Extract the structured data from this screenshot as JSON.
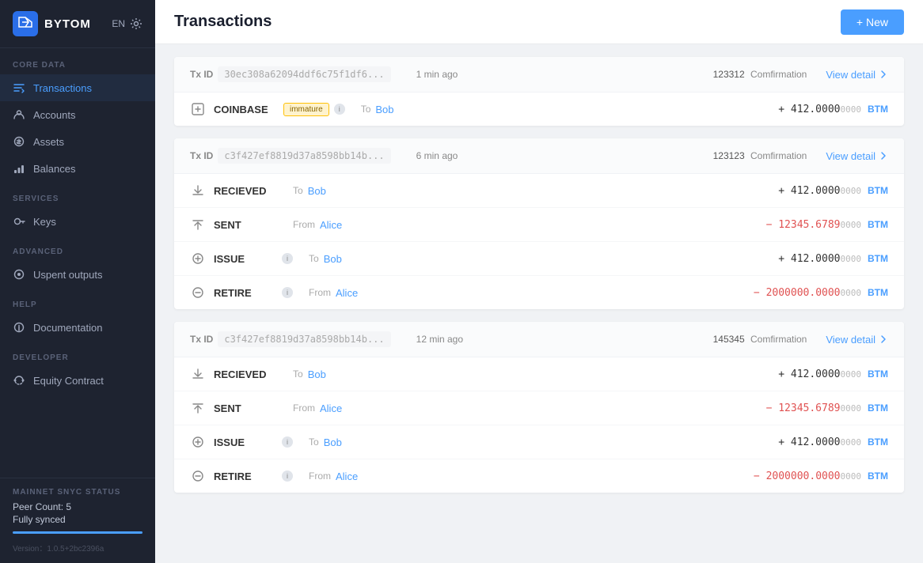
{
  "app": {
    "logo": "BYTOM",
    "lang": "EN",
    "page_title": "Transactions",
    "new_button": "+ New"
  },
  "sidebar": {
    "sections": [
      {
        "label": "CORE DATA",
        "items": [
          {
            "id": "transactions",
            "label": "Transactions",
            "icon": "tx-icon",
            "active": true
          },
          {
            "id": "accounts",
            "label": "Accounts",
            "icon": "accounts-icon",
            "active": false
          },
          {
            "id": "assets",
            "label": "Assets",
            "icon": "assets-icon",
            "active": false
          },
          {
            "id": "balances",
            "label": "Balances",
            "icon": "balances-icon",
            "active": false
          }
        ]
      },
      {
        "label": "SERVICES",
        "items": [
          {
            "id": "keys",
            "label": "Keys",
            "icon": "keys-icon",
            "active": false
          }
        ]
      },
      {
        "label": "ADVANCED",
        "items": [
          {
            "id": "unspent",
            "label": "Uspent outputs",
            "icon": "unspent-icon",
            "active": false
          }
        ]
      },
      {
        "label": "HELP",
        "items": [
          {
            "id": "docs",
            "label": "Documentation",
            "icon": "docs-icon",
            "active": false
          }
        ]
      },
      {
        "label": "DEVELOPER",
        "items": [
          {
            "id": "equity",
            "label": "Equity Contract",
            "icon": "equity-icon",
            "active": false
          }
        ]
      }
    ],
    "sync": {
      "label": "MAINNET SNYC STATUS",
      "peer_count": "Peer Count: 5",
      "status": "Fully synced",
      "bar_width": "100%"
    },
    "version": "Version：1.0.5+2bc2396a"
  },
  "transactions": [
    {
      "tx_id": "30ec308a62094ddf6c75f1df6...",
      "time": "1 min ago",
      "confirmation_num": "123312",
      "confirmation_label": "Comfirmation",
      "view_detail": "View detail",
      "rows": [
        {
          "type": "COINBASE",
          "badge": "immature",
          "badge_class": "immature",
          "direction": "To",
          "name": "Bob",
          "amount_sign": "+",
          "amount_main": "412.0000",
          "amount_small": "0000",
          "currency": "BTM",
          "is_positive": true
        }
      ]
    },
    {
      "tx_id": "c3f427ef8819d37a8598bb14b...",
      "time": "6 min ago",
      "confirmation_num": "123123",
      "confirmation_label": "Comfirmation",
      "view_detail": "View detail",
      "rows": [
        {
          "type": "RECIEVED",
          "badge": null,
          "direction": "To",
          "name": "Bob",
          "amount_sign": "+",
          "amount_main": "412.0000",
          "amount_small": "0000",
          "currency": "BTM",
          "is_positive": true
        },
        {
          "type": "SENT",
          "badge": null,
          "direction": "From",
          "name": "Alice",
          "amount_sign": "−",
          "amount_main": "12345.6789",
          "amount_small": "0000",
          "currency": "BTM",
          "is_positive": false
        },
        {
          "type": "ISSUE",
          "badge": "info",
          "direction": "To",
          "name": "Bob",
          "amount_sign": "+",
          "amount_main": "412.0000",
          "amount_small": "0000",
          "currency": "BTM",
          "is_positive": true
        },
        {
          "type": "RETIRE",
          "badge": "info",
          "direction": "From",
          "name": "Alice",
          "amount_sign": "−",
          "amount_main": "2000000.0000",
          "amount_small": "0000",
          "currency": "BTM",
          "is_positive": false
        }
      ]
    },
    {
      "tx_id": "c3f427ef8819d37a8598bb14b...",
      "time": "12 min ago",
      "confirmation_num": "145345",
      "confirmation_label": "Comfirmation",
      "view_detail": "View detail",
      "rows": [
        {
          "type": "RECIEVED",
          "badge": null,
          "direction": "To",
          "name": "Bob",
          "amount_sign": "+",
          "amount_main": "412.0000",
          "amount_small": "0000",
          "currency": "BTM",
          "is_positive": true
        },
        {
          "type": "SENT",
          "badge": null,
          "direction": "From",
          "name": "Alice",
          "amount_sign": "−",
          "amount_main": "12345.6789",
          "amount_small": "0000",
          "currency": "BTM",
          "is_positive": false
        },
        {
          "type": "ISSUE",
          "badge": "info",
          "direction": "To",
          "name": "Bob",
          "amount_sign": "+",
          "amount_main": "412.0000",
          "amount_small": "0000",
          "currency": "BTM",
          "is_positive": true
        },
        {
          "type": "RETIRE",
          "badge": "info",
          "direction": "From",
          "name": "Alice",
          "amount_sign": "−",
          "amount_main": "2000000.0000",
          "amount_small": "0000",
          "currency": "BTM",
          "is_positive": false
        }
      ]
    }
  ]
}
